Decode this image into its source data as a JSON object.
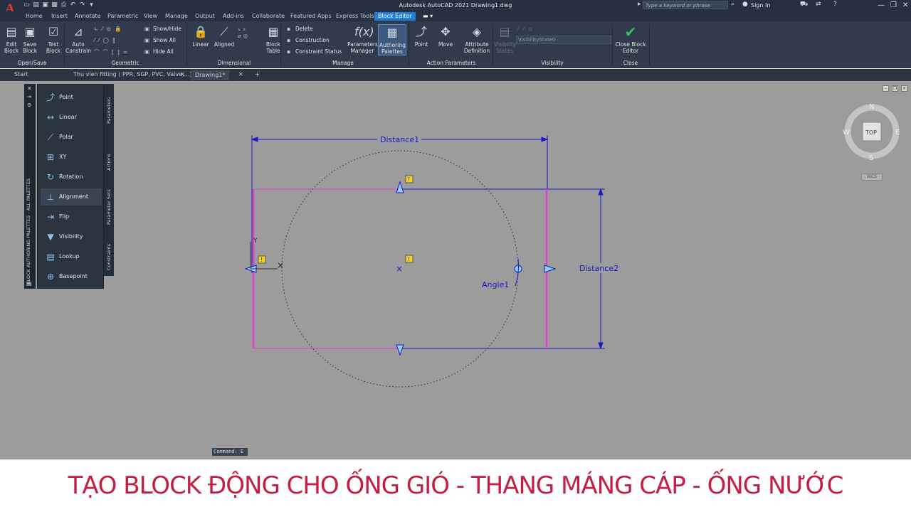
{
  "app": {
    "logo": "A",
    "window_title": "Autodesk AutoCAD 2021    Drawing1.dwg",
    "search_placeholder": "Type a keyword or phrase",
    "sign_in": "Sign In",
    "qat_icons": [
      "new-icon",
      "open-icon",
      "save-icon",
      "save-as-icon",
      "print-icon",
      "undo-icon",
      "redo-icon",
      "dropdown-icon"
    ]
  },
  "ribbon_tabs": [
    "Home",
    "Insert",
    "Annotate",
    "Parametric",
    "View",
    "Manage",
    "Output",
    "Add-ins",
    "Collaborate",
    "Featured Apps",
    "Express Tools",
    "Block Editor"
  ],
  "ribbon": {
    "open_save": {
      "label": "Open/Save",
      "edit_block": "Edit Block",
      "save_block": "Save Block",
      "test_block": "Test Block"
    },
    "geometric": {
      "label": "Geometric",
      "auto_constrain": "Auto Constrain",
      "show_hide": "Show/Hide",
      "show_all": "Show All",
      "hide_all": "Hide All"
    },
    "dimensional": {
      "label": "Dimensional",
      "linear": "Linear",
      "aligned": "Aligned"
    },
    "manage": {
      "label": "Manage",
      "block_table": "Block Table",
      "delete": "Delete",
      "construction": "Construction",
      "constraint_status": "Constraint Status",
      "parameters_manager": "Parameters Manager",
      "authoring_palettes": "Authoring Palettes"
    },
    "action_parameters": {
      "label": "Action Parameters",
      "point": "Point",
      "move": "Move",
      "attribute_definition": "Attribute Definition"
    },
    "visibility": {
      "label": "Visibility",
      "visibility_states": "Visibility States",
      "state_value": "VisibilityState0"
    },
    "close": {
      "label": "Close",
      "close_block_editor": "Close Block Editor"
    }
  },
  "doc_tabs": [
    {
      "label": "Start"
    },
    {
      "label": "Thu vien fitting ( PPR, SGP, PVC, Valve,...)*"
    },
    {
      "label": "Drawing1*"
    }
  ],
  "palette": {
    "title": "BLOCK AUTHORING PALETTES - ALL PALETTES",
    "items": [
      "Point",
      "Linear",
      "Polar",
      "XY",
      "Rotation",
      "Alignment",
      "Flip",
      "Visibility",
      "Lookup",
      "Basepoint"
    ],
    "tabs": [
      "Parameters",
      "Actions",
      "Parameter Sets",
      "Constraints"
    ]
  },
  "drawing": {
    "labels": {
      "distance1": "Distance1",
      "distance2": "Distance2",
      "angle1": "Angle1"
    },
    "alert_mark": "!",
    "ucs_y": "Y"
  },
  "viewcube": {
    "n": "N",
    "s": "S",
    "e": "E",
    "w": "W",
    "face": "TOP",
    "wcs": "WCS"
  },
  "command_line": "Command: E",
  "banner": "TẠO BLOCK ĐỘNG CHO ỐNG GIÓ - THANG MÁNG CÁP - ỐNG NƯỚC",
  "colors": {
    "dimension": "#1818c8",
    "block_edge": "#e040d0",
    "banner_text": "#c41e45",
    "canvas": "#9c9c9c",
    "ribbon_active": "#1f7fd6"
  }
}
